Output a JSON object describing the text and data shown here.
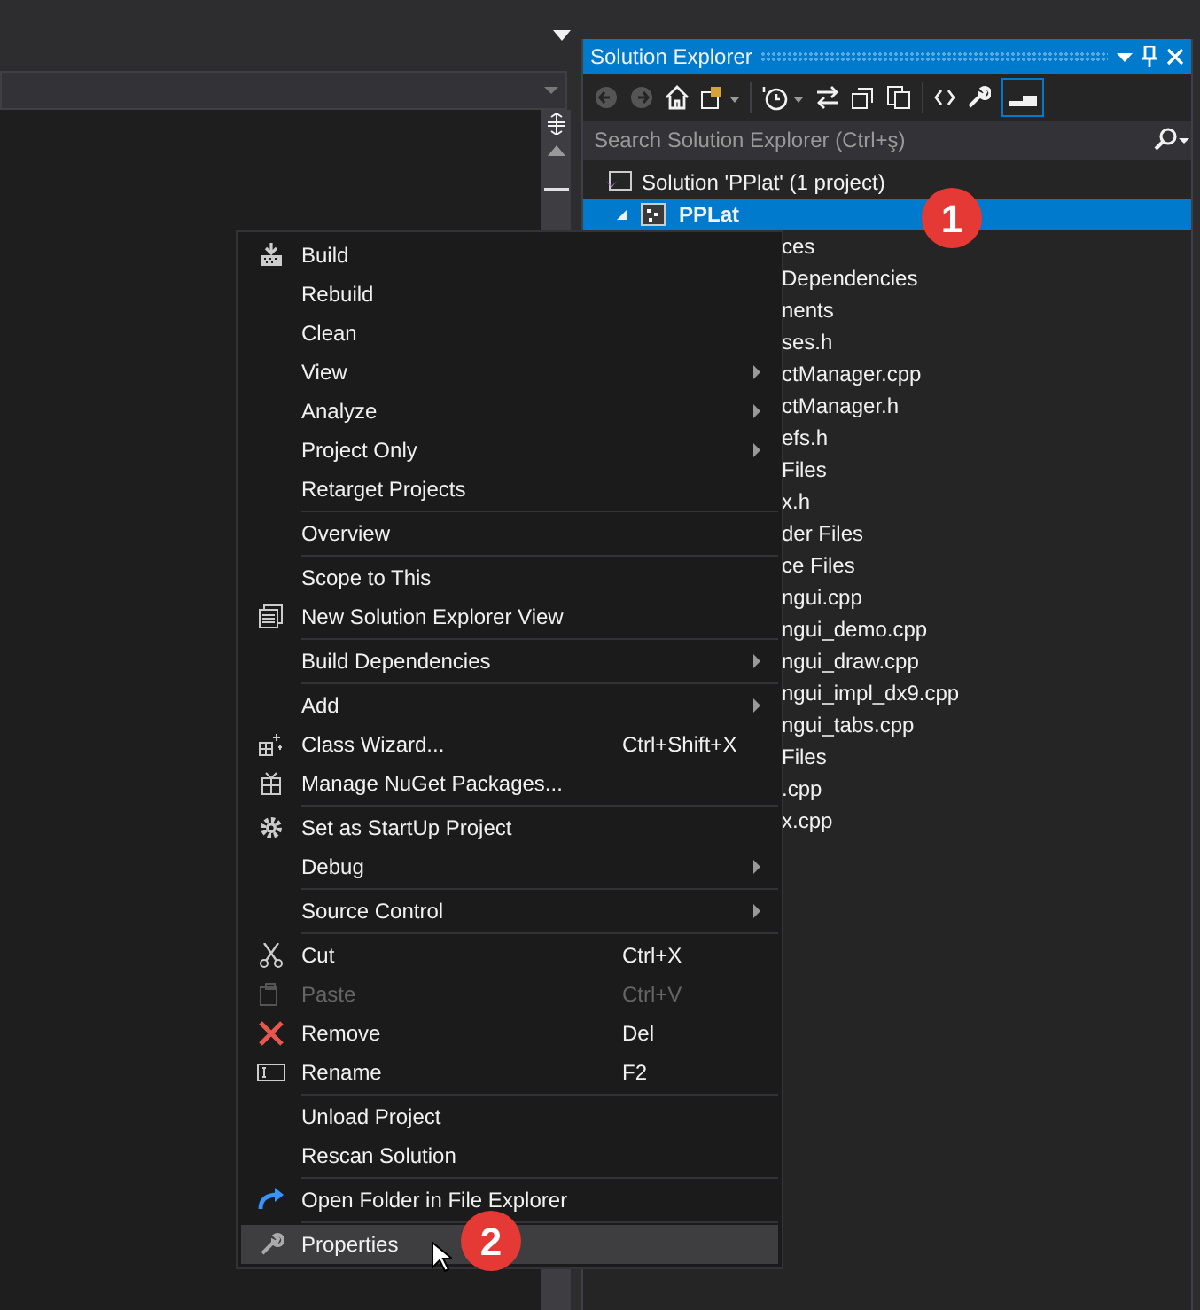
{
  "solution_explorer": {
    "title": "Solution Explorer",
    "search": {
      "placeholder": "Search Solution Explorer (Ctrl+ş)"
    },
    "tree": [
      {
        "label": "Solution 'PPlat' (1 project)",
        "selected": false,
        "children": [
          {
            "label": "PPLat",
            "selected": true,
            "expanded": true,
            "children": [
              {
                "label": "ces"
              },
              {
                "label": "Dependencies"
              },
              {
                "label": "nents"
              },
              {
                "label": "ses.h"
              },
              {
                "label": "ctManager.cpp"
              },
              {
                "label": "ctManager.h"
              },
              {
                "label": "efs.h"
              },
              {
                "label": "Files"
              },
              {
                "label": "x.h"
              },
              {
                "label": "der Files"
              },
              {
                "label": "ce Files"
              },
              {
                "label": "ngui.cpp"
              },
              {
                "label": "ngui_demo.cpp"
              },
              {
                "label": "ngui_draw.cpp"
              },
              {
                "label": "ngui_impl_dx9.cpp"
              },
              {
                "label": "ngui_tabs.cpp"
              },
              {
                "label": "Files"
              },
              {
                "label": ".cpp"
              },
              {
                "label": "x.cpp"
              }
            ]
          }
        ]
      }
    ]
  },
  "context_menu": {
    "groups": [
      [
        {
          "label": "Build",
          "submenu": false,
          "disabled": false,
          "selected": false
        },
        {
          "label": "Rebuild",
          "submenu": false,
          "disabled": false,
          "selected": false
        },
        {
          "label": "Clean",
          "submenu": false,
          "disabled": false,
          "selected": false
        },
        {
          "label": "View",
          "submenu": true,
          "disabled": false,
          "selected": false
        },
        {
          "label": "Analyze",
          "submenu": true,
          "disabled": false,
          "selected": false
        },
        {
          "label": "Project Only",
          "submenu": true,
          "disabled": false,
          "selected": false
        },
        {
          "label": "Retarget Projects",
          "submenu": false,
          "disabled": false,
          "selected": false
        }
      ],
      [
        {
          "label": "Overview",
          "submenu": false,
          "disabled": false,
          "selected": false
        }
      ],
      [
        {
          "label": "Scope to This",
          "submenu": false,
          "disabled": false,
          "selected": false
        },
        {
          "label": "New Solution Explorer View",
          "submenu": false,
          "disabled": false,
          "selected": false
        }
      ],
      [
        {
          "label": "Build Dependencies",
          "submenu": true,
          "disabled": false,
          "selected": false
        }
      ],
      [
        {
          "label": "Add",
          "submenu": true,
          "disabled": false,
          "selected": false
        },
        {
          "label": "Class Wizard...",
          "shortcut": "Ctrl+Shift+X",
          "submenu": false,
          "disabled": false,
          "selected": false
        },
        {
          "label": "Manage NuGet Packages...",
          "submenu": false,
          "disabled": false,
          "selected": false
        }
      ],
      [
        {
          "label": "Set as StartUp Project",
          "submenu": false,
          "disabled": false,
          "selected": false
        },
        {
          "label": "Debug",
          "submenu": true,
          "disabled": false,
          "selected": false
        }
      ],
      [
        {
          "label": "Source Control",
          "submenu": true,
          "disabled": false,
          "selected": false
        }
      ],
      [
        {
          "label": "Cut",
          "shortcut": "Ctrl+X",
          "submenu": false,
          "disabled": false,
          "selected": false
        },
        {
          "label": "Paste",
          "shortcut": "Ctrl+V",
          "submenu": false,
          "disabled": true,
          "selected": false
        },
        {
          "label": "Remove",
          "shortcut": "Del",
          "submenu": false,
          "disabled": false,
          "selected": false
        },
        {
          "label": "Rename",
          "shortcut": "F2",
          "submenu": false,
          "disabled": false,
          "selected": false
        }
      ],
      [
        {
          "label": "Unload Project",
          "submenu": false,
          "disabled": false,
          "selected": false
        },
        {
          "label": "Rescan Solution",
          "submenu": false,
          "disabled": false,
          "selected": false
        }
      ],
      [
        {
          "label": "Open Folder in File Explorer",
          "submenu": false,
          "disabled": false,
          "selected": false
        }
      ],
      [
        {
          "label": "Properties",
          "submenu": false,
          "disabled": false,
          "selected": true
        }
      ]
    ]
  },
  "callouts": [
    "1",
    "2"
  ]
}
